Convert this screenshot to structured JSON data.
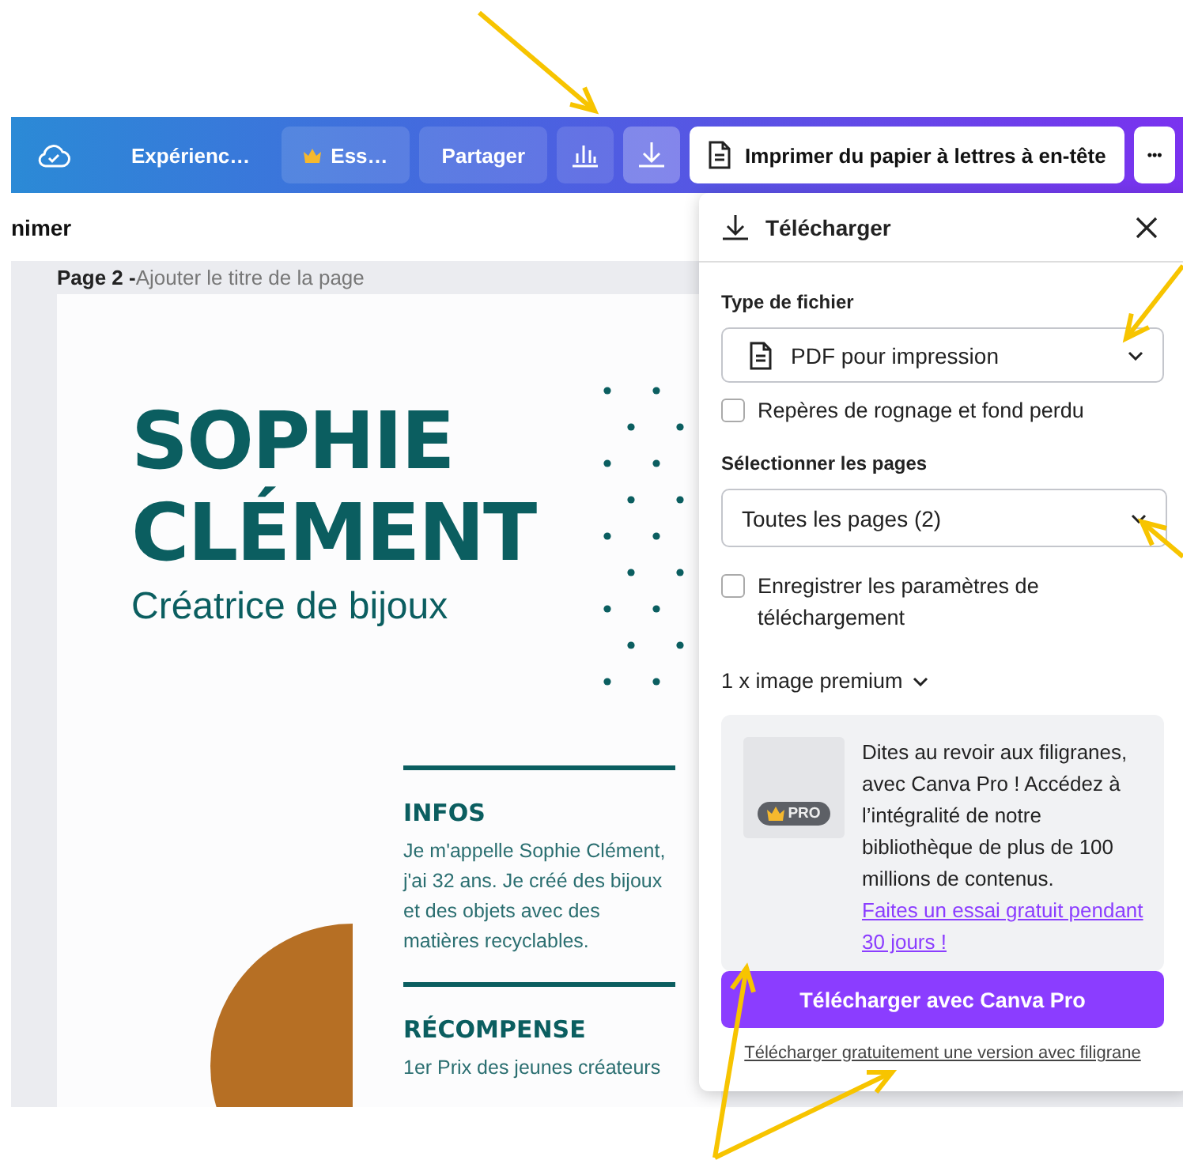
{
  "toolbar": {
    "items": [
      {
        "kind": "sync"
      },
      {
        "kind": "text",
        "label": "Expérienc…"
      },
      {
        "kind": "premium",
        "label": "Ess…"
      },
      {
        "kind": "button",
        "label": "Partager"
      },
      {
        "kind": "chart",
        "selected": false
      },
      {
        "kind": "download",
        "selected": true
      },
      {
        "kind": "print",
        "label": "Imprimer du papier à lettres à en-tête"
      },
      {
        "kind": "more",
        "label": "•••"
      }
    ]
  },
  "subbar": {
    "label": "nimer"
  },
  "canvas": {
    "page_label": "Page 2 - ",
    "page_title_placeholder": "Ajouter le titre de la page",
    "page": {
      "name_lines": [
        "SOPHIE",
        "CLÉMENT"
      ],
      "subtitle": "Créatrice de bijoux",
      "sections": [
        {
          "heading": "INFOS",
          "text": "Je m'appelle Sophie Clément, j'ai 32 ans. Je créé des bijoux et des objets avec des matières recyclables."
        },
        {
          "heading": "RÉCOMPENSE",
          "text": "1er Prix des jeunes créateurs"
        }
      ]
    }
  },
  "download_panel": {
    "title": "Télécharger",
    "file_type": {
      "label": "Type de fichier",
      "value": "PDF pour impression"
    },
    "crop_marks": {
      "label": "Repères de rognage et fond perdu",
      "checked": false
    },
    "pages": {
      "label": "Sélectionner les pages",
      "value": "Toutes les pages (2)"
    },
    "save_settings": {
      "label": "Enregistrer les paramètres de téléchargement",
      "checked": false
    },
    "premium_toggle": "1 x image premium",
    "promo": {
      "badge": "PRO",
      "text": "Dites au revoir aux filigranes, avec Canva Pro ! Accédez à l’intégralité de notre bibliothèque de plus de 100 millions de contenus.",
      "link": "Faites un essai gratuit pendant 30 jours !"
    },
    "primary_button": "Télécharger avec Canva Pro",
    "secondary_link": "Télécharger gratuitement une version avec filigrane"
  }
}
